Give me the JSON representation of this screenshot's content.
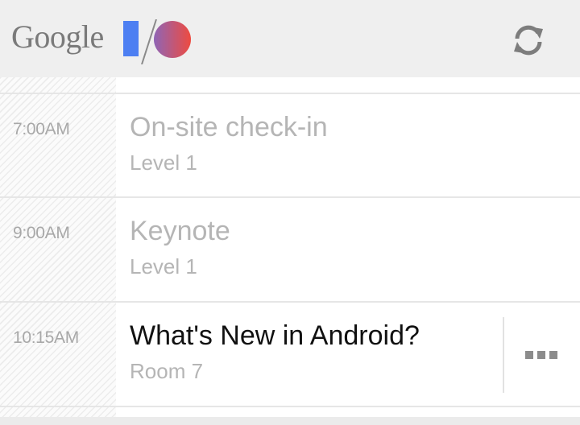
{
  "app": {
    "logo_text": "Google",
    "colors": {
      "io_blue": "#4d7ff2",
      "io_red_start": "#8f65b6",
      "io_red_end": "#ee4b40"
    },
    "refresh_icon": "refresh-icon"
  },
  "schedule": [
    {
      "time": "7:00AM",
      "title": "On-site check-in",
      "subtitle": "Level 1",
      "active": false
    },
    {
      "time": "9:00AM",
      "title": "Keynote",
      "subtitle": "Level 1",
      "active": false
    },
    {
      "time": "10:15AM",
      "title": "What's New in Android?",
      "subtitle": "Room 7",
      "active": true,
      "overflow_icon": "overflow-menu-icon"
    }
  ]
}
